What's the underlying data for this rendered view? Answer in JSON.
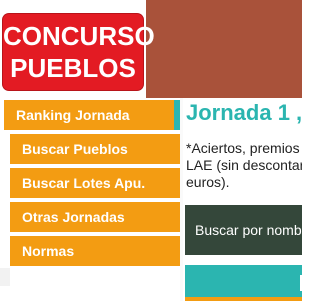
{
  "logo": {
    "line1": "CONCURSO",
    "line2": "PUEBLOS"
  },
  "sidebar": {
    "items": [
      {
        "label": "Ranking Jornada",
        "active": true
      },
      {
        "label": "Buscar Pueblos"
      },
      {
        "label": "Buscar Lotes Apu."
      },
      {
        "label": "Otras Jornadas"
      },
      {
        "label": "Normas"
      }
    ]
  },
  "main": {
    "title": "Jornada 1 ,",
    "desc_line1": "*Aciertos, premios",
    "desc_line2": "LAE (sin descontar",
    "desc_line3": "euros).",
    "search_label": "Buscar por nombre"
  },
  "colors": {
    "header": "#a9523a",
    "logo_bg": "#e31b23",
    "nav": "#f39c12",
    "accent": "#2bb5b0",
    "button_dark": "#34473a"
  }
}
